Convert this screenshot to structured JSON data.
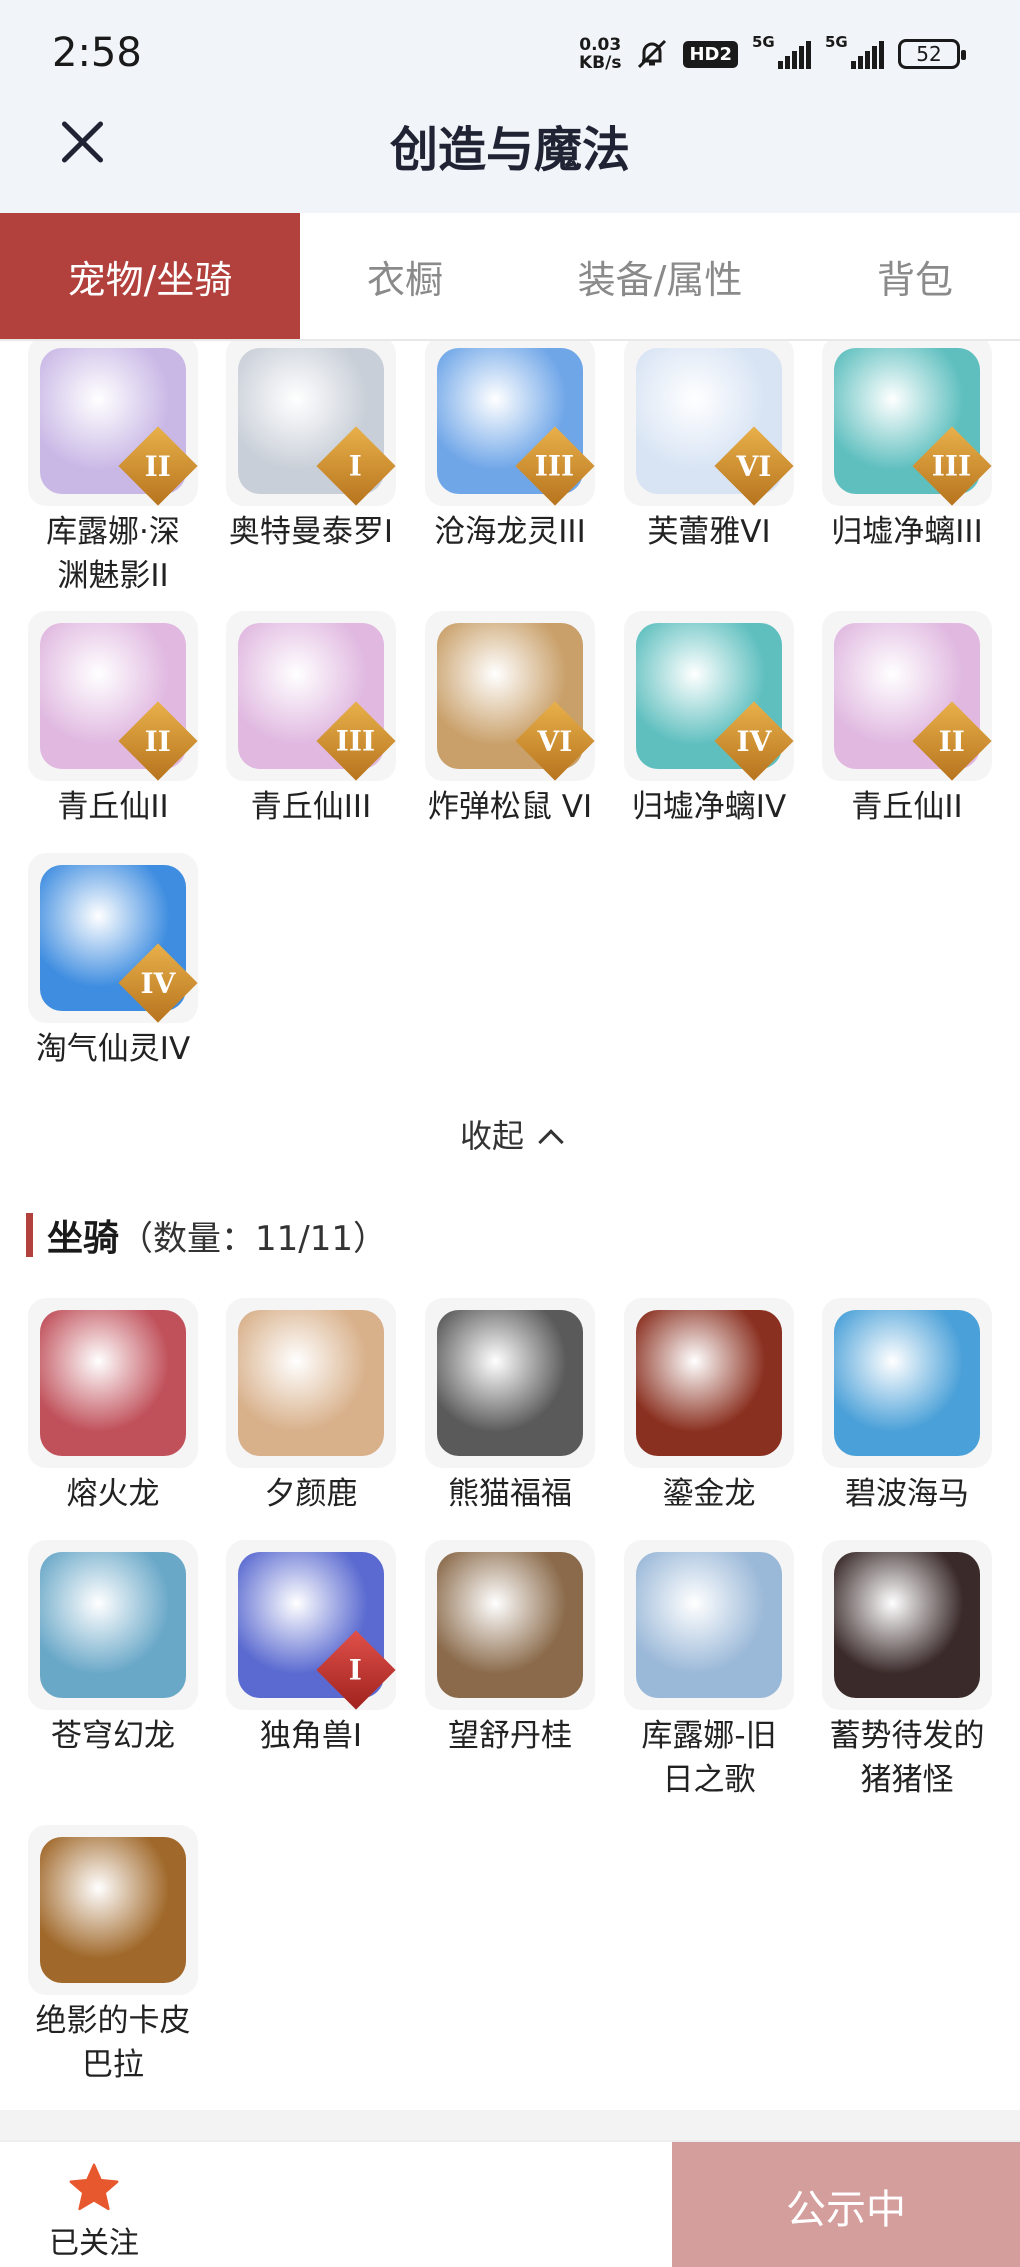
{
  "status": {
    "time": "2:58",
    "speed_top": "0.03",
    "speed_unit": "KB/s",
    "hd_label": "HD2",
    "net1": "5G",
    "net2": "5G",
    "battery": "52"
  },
  "header": {
    "title": "创造与魔法"
  },
  "tabs": [
    {
      "label": "宠物/坐骑",
      "active": true
    },
    {
      "label": "衣橱",
      "active": false
    },
    {
      "label": "装备/属性",
      "active": false
    },
    {
      "label": "背包",
      "active": false
    }
  ],
  "pets": [
    {
      "name": "库露娜·深\n渊魅影II",
      "badge": "II",
      "color": "#c9b8e6"
    },
    {
      "name": "奥特曼泰罗I",
      "badge": "I",
      "color": "#c9cfd8"
    },
    {
      "name": "沧海龙灵III",
      "badge": "III",
      "color": "#6fa6e8"
    },
    {
      "name": "芙蕾雅VI",
      "badge": "VI",
      "color": "#d8e4f4"
    },
    {
      "name": "归墟净螭III",
      "badge": "III",
      "color": "#5fbfbf"
    },
    {
      "name": "青丘仙II",
      "badge": "II",
      "color": "#e0b8e0"
    },
    {
      "name": "青丘仙III",
      "badge": "III",
      "color": "#e0b8e0"
    },
    {
      "name": "炸弹松鼠 VI",
      "badge": "VI",
      "color": "#c9a06a"
    },
    {
      "name": "归墟净螭IV",
      "badge": "IV",
      "color": "#5fbfbf"
    },
    {
      "name": "青丘仙II",
      "badge": "II",
      "color": "#e0b8e0"
    },
    {
      "name": "淘气仙灵IV",
      "badge": "IV",
      "color": "#3f8de0"
    }
  ],
  "collapse_label": "收起",
  "mounts_section": {
    "title": "坐骑",
    "count": "（数量：11/11）"
  },
  "mounts": [
    {
      "name": "熔火龙",
      "badge": "",
      "color": "#c0505a"
    },
    {
      "name": "夕颜鹿",
      "badge": "",
      "color": "#d8b08a"
    },
    {
      "name": "熊猫福福",
      "badge": "",
      "color": "#5a5a5a"
    },
    {
      "name": "鎏金龙",
      "badge": "",
      "color": "#8a3020"
    },
    {
      "name": "碧波海马",
      "badge": "",
      "color": "#4aa0d8"
    },
    {
      "name": "苍穹幻龙",
      "badge": "",
      "color": "#6aa8c8"
    },
    {
      "name": "独角兽I",
      "badge": "I",
      "color": "#5a6ad0"
    },
    {
      "name": "望舒丹桂",
      "badge": "",
      "color": "#8a6a4a"
    },
    {
      "name": "库露娜-旧\n日之歌",
      "badge": "",
      "color": "#9ab8d8"
    },
    {
      "name": "蓄势待发的\n猪猪怪",
      "badge": "",
      "color": "#3a2a2a"
    },
    {
      "name": "绝影的卡皮\n巴拉",
      "badge": "",
      "color": "#a0682a"
    }
  ],
  "bottom": {
    "follow_label": "已关注",
    "public_label": "公示中"
  }
}
